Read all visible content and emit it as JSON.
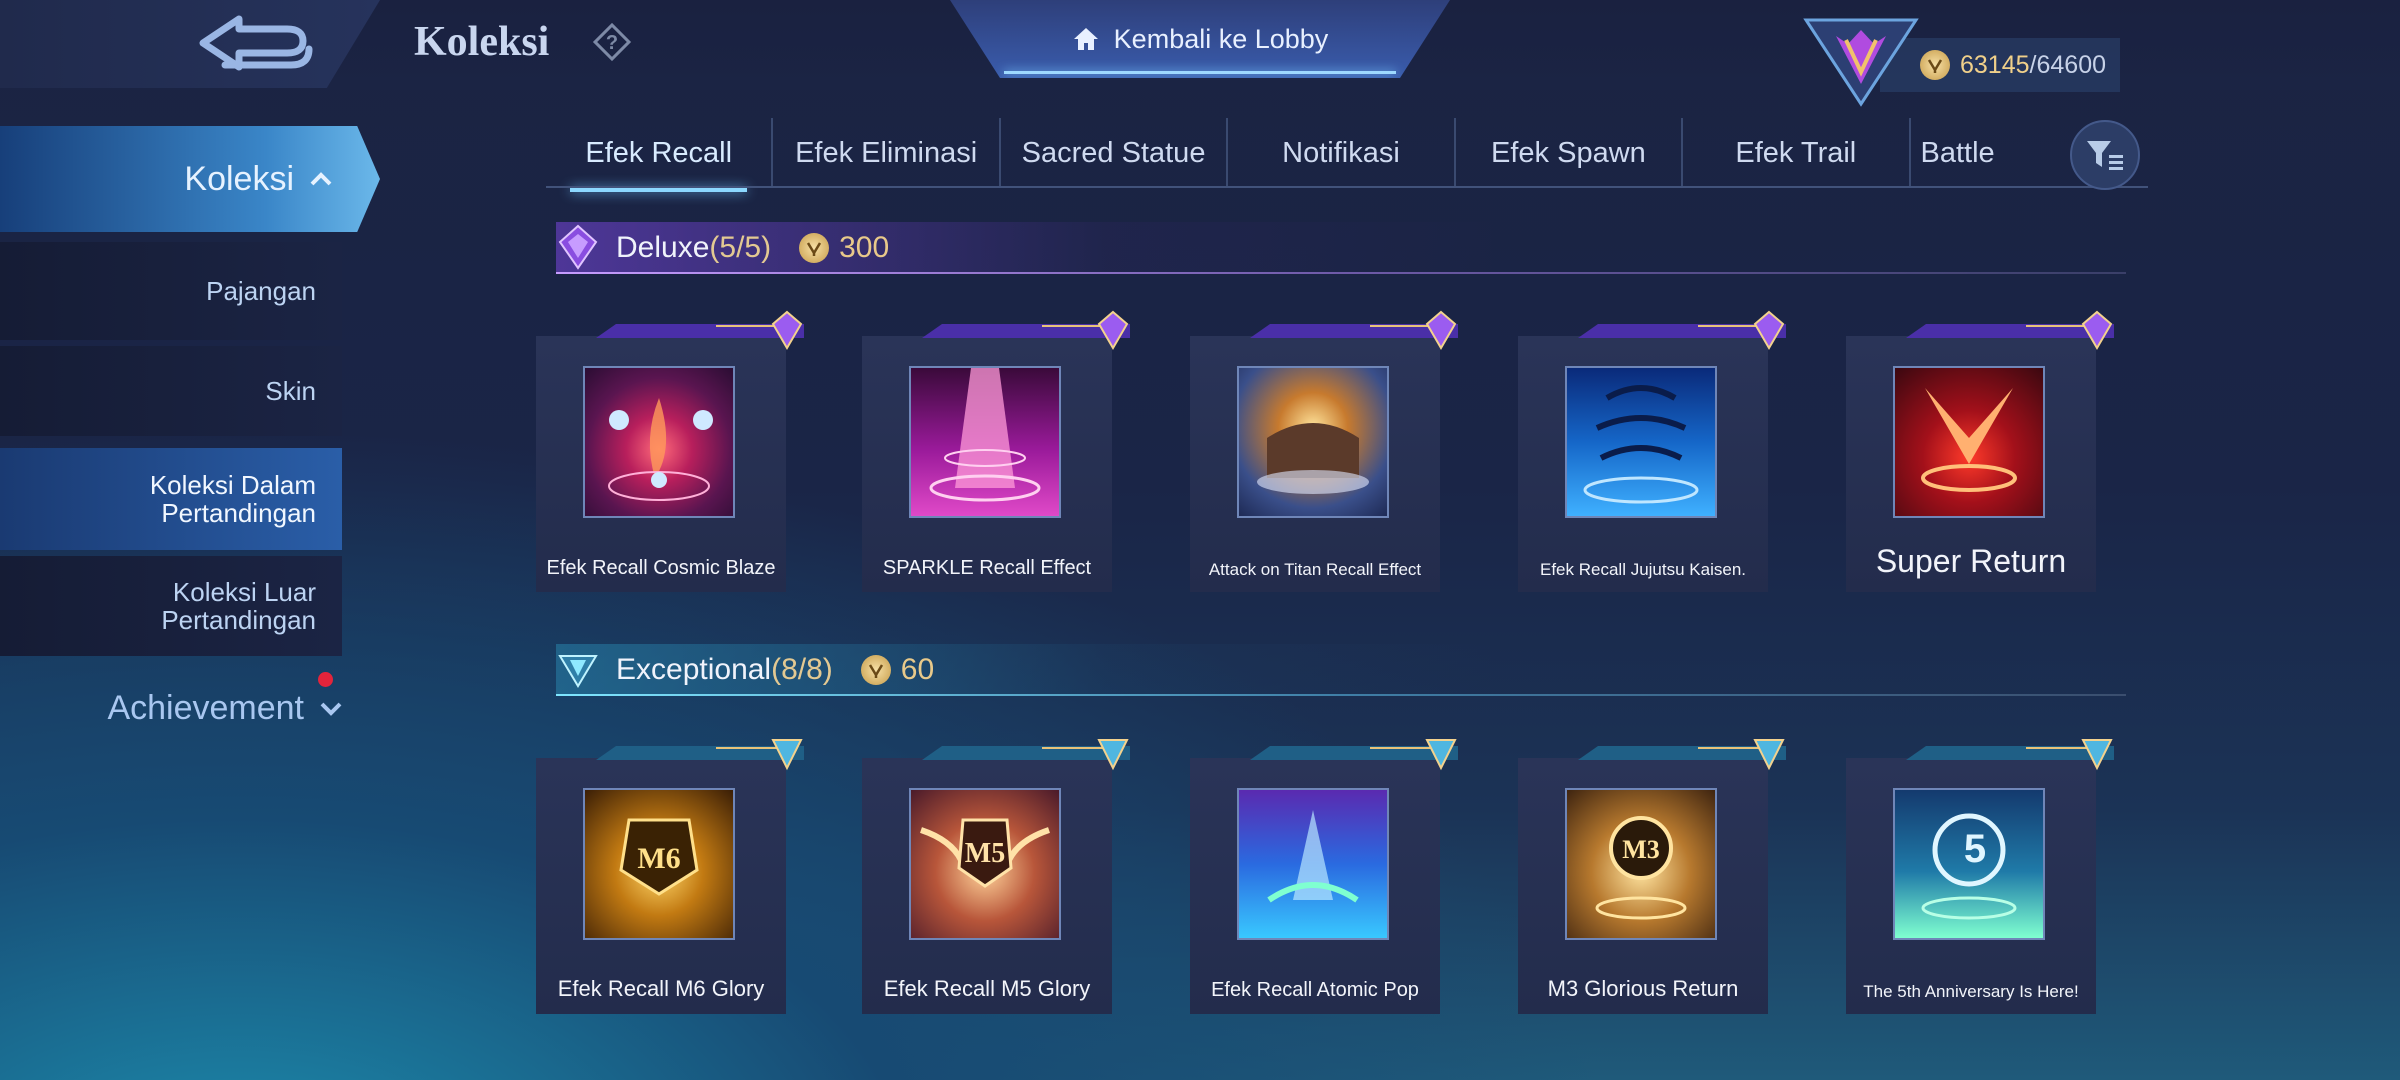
{
  "header": {
    "title": "Koleksi",
    "lobby_label": "Kembali ke Lobby",
    "points_current": "63145",
    "points_total": "/64600"
  },
  "sidebar": {
    "items": [
      {
        "label": "Koleksi",
        "active": true
      },
      {
        "label": "Pajangan"
      },
      {
        "label": "Skin"
      },
      {
        "label": "Koleksi Dalam Pertandingan",
        "selected": true
      },
      {
        "label": "Koleksi Luar Pertandingan"
      }
    ],
    "achievement": "Achievement"
  },
  "tabs": [
    "Efek Recall",
    "Efek Eliminasi",
    "Sacred Statue",
    "Notifikasi",
    "Efek Spawn",
    "Efek Trail",
    "Battle"
  ],
  "sections": [
    {
      "name": "Deluxe",
      "count": "(5/5)",
      "price": "300",
      "accent": "#a56bff",
      "items": [
        "Efek Recall Cosmic Blaze",
        "SPARKLE Recall Effect",
        "Attack on Titan Recall Effect",
        "Efek Recall Jujutsu Kaisen.",
        "Super Return"
      ]
    },
    {
      "name": "Exceptional",
      "count": "(8/8)",
      "price": "60",
      "accent": "#6fe3ff",
      "items": [
        "Efek Recall M6 Glory",
        "Efek Recall M5 Glory",
        "Efek Recall Atomic Pop",
        "M3 Glorious Return",
        "The 5th Anniversary Is Here!"
      ]
    }
  ]
}
